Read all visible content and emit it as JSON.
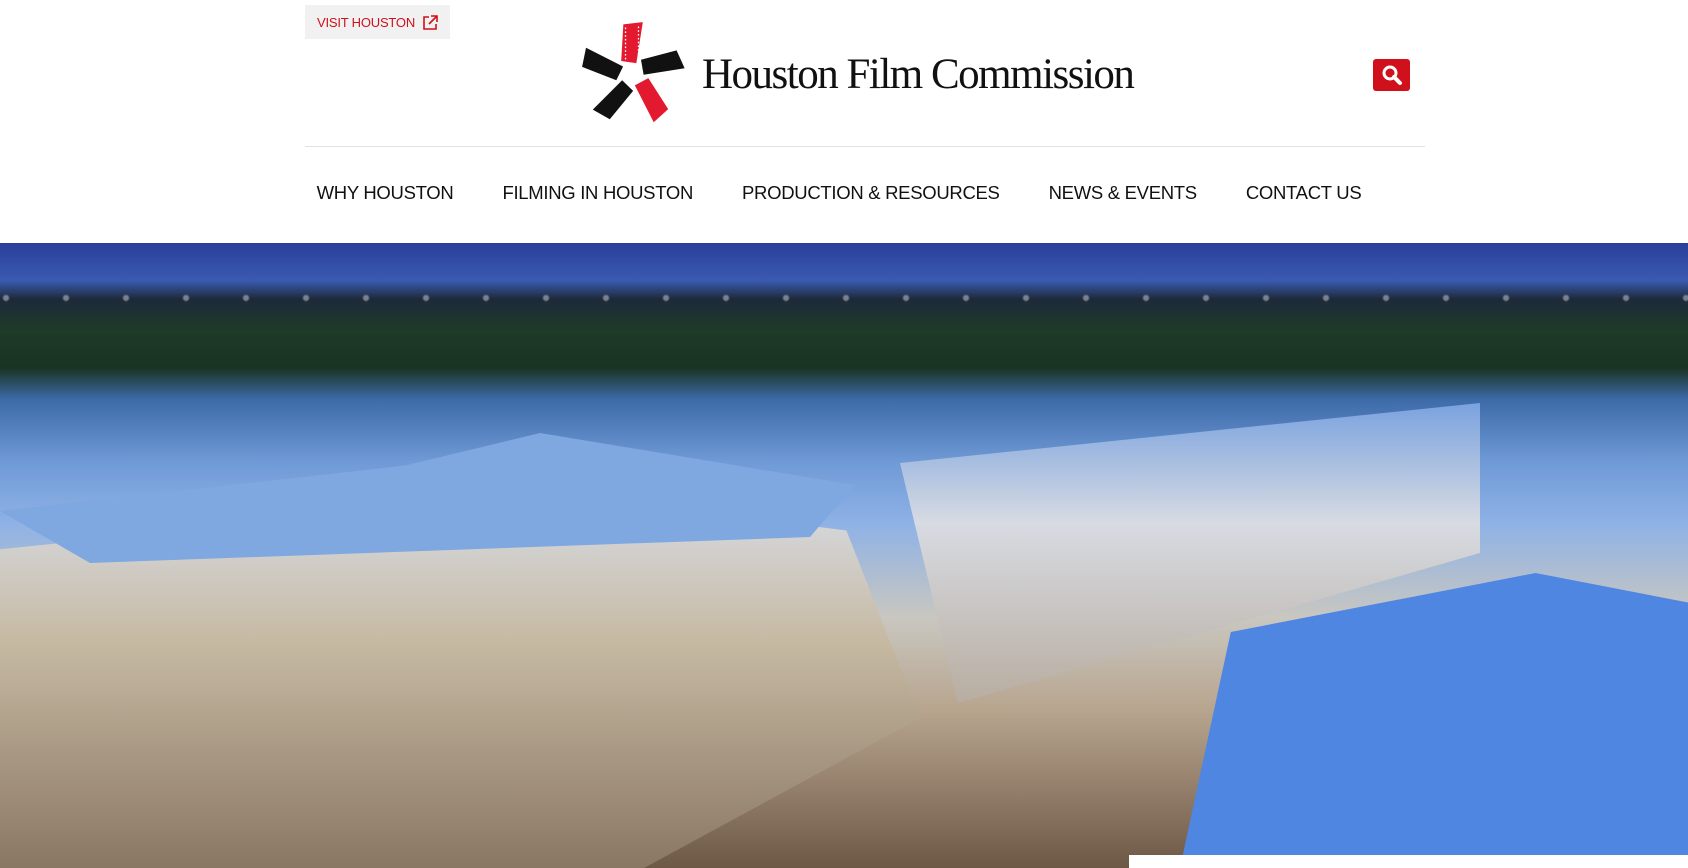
{
  "top_link": {
    "label": "VISIT HOUSTON",
    "icon": "external-link-icon"
  },
  "logo": {
    "text": "Houston Film Commission"
  },
  "search": {
    "icon": "search-icon"
  },
  "nav": [
    "WHY HOUSTON",
    "FILMING IN HOUSTON",
    "PRODUCTION & RESOURCES",
    "NEWS & EVENTS",
    "CONTACT US"
  ],
  "colors": {
    "brand_red": "#d0111b"
  }
}
